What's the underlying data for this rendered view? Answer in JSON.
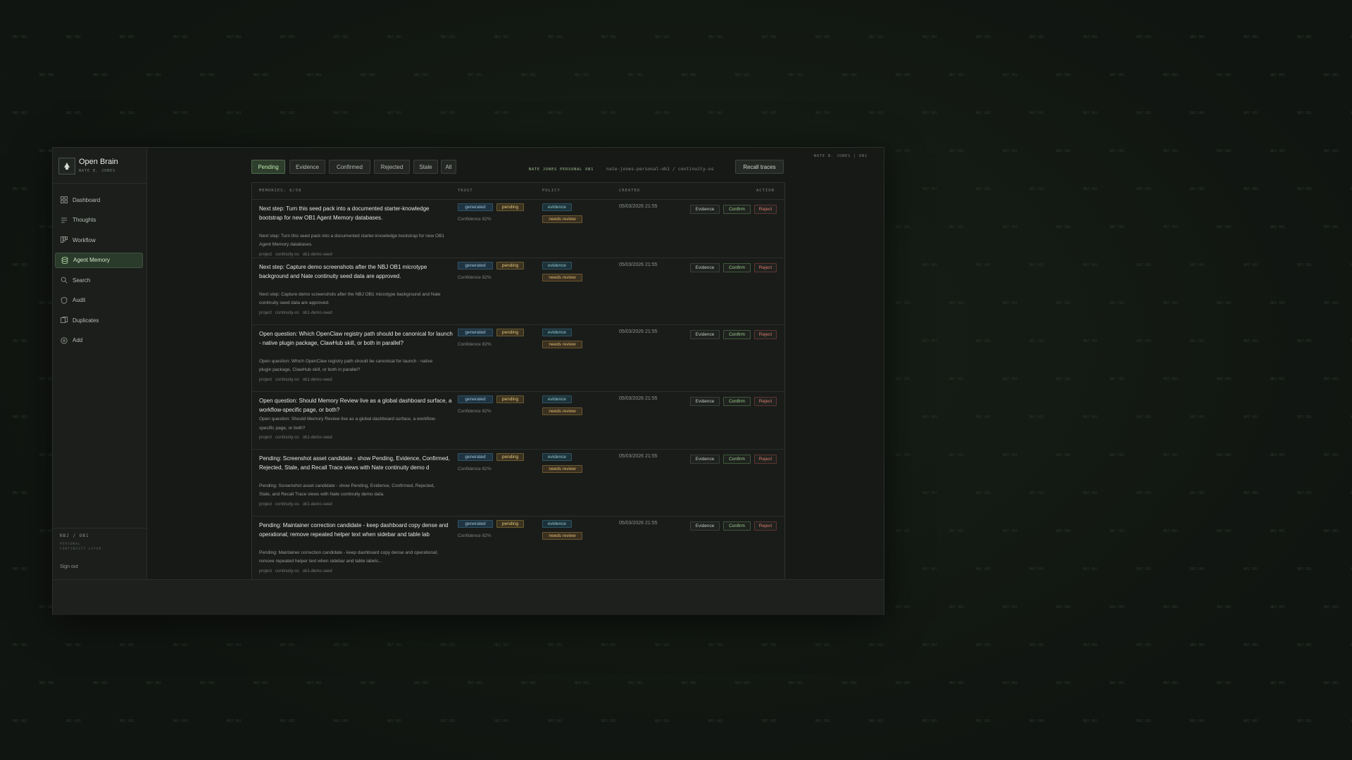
{
  "app": {
    "title": "Open Brain",
    "subtitle": "NATE B. JONES"
  },
  "sidebar": {
    "items": [
      {
        "label": "Dashboard",
        "icon": "dashboard-icon"
      },
      {
        "label": "Thoughts",
        "icon": "thoughts-icon"
      },
      {
        "label": "Workflow",
        "icon": "workflow-icon"
      },
      {
        "label": "Agent Memory",
        "icon": "database-icon",
        "active": true
      },
      {
        "label": "Search",
        "icon": "search-icon"
      },
      {
        "label": "Audit",
        "icon": "shield-icon"
      },
      {
        "label": "Duplicates",
        "icon": "duplicates-icon"
      },
      {
        "label": "Add",
        "icon": "plus-circle-icon"
      }
    ],
    "footer_code": "NBJ / OB1",
    "footer_tagline": "PERSONAL CONTINUITY LAYER",
    "signout": "Sign out"
  },
  "topbar": {
    "tabs": [
      "Pending",
      "Evidence",
      "Confirmed",
      "Rejected",
      "Stale",
      "All"
    ],
    "active_tab": "Pending",
    "context_label": "NATE JONES PERSONAL OB1",
    "context_path": "nate-jones-personal-ob1 / continuity-os",
    "recall_button": "Recall traces",
    "owner": "NATE B. JONES | OB1"
  },
  "table": {
    "headers": {
      "memories": "MEMORIES: 8/58",
      "trust": "TRUST",
      "policy": "POLICY",
      "created": "CREATED",
      "action": "ACTION"
    },
    "rows": [
      {
        "title": "Next step: Turn this seed pack into a documented starter-knowledge bootstrap for new OB1 Agent Memory databases.",
        "desc": "Next step: Turn this seed pack into a documented starter-knowledge bootstrap for new OB1 Agent Memory databases.",
        "tags": [
          "project",
          "continuity-os",
          "ob1-demo-seed"
        ],
        "trust": [
          "generated",
          "pending"
        ],
        "confidence": "Confidence 82%",
        "policy": [
          "evidence",
          "needs review"
        ],
        "created": "05/03/2026 21:55",
        "actions": [
          "Evidence",
          "Confirm",
          "Reject"
        ]
      },
      {
        "title": "Next step: Capture demo screenshots after the NBJ OB1 microtype background and Nate continuity seed data are approved.",
        "desc": "Next step: Capture demo screenshots after the NBJ OB1 microtype background and Nate continuity seed data are approved.",
        "tags": [
          "project",
          "continuity-os",
          "ob1-demo-seed"
        ],
        "trust": [
          "generated",
          "pending"
        ],
        "confidence": "Confidence 82%",
        "policy": [
          "evidence",
          "needs review"
        ],
        "created": "05/03/2026 21:55",
        "actions": [
          "Evidence",
          "Confirm",
          "Reject"
        ]
      },
      {
        "title": "Open question: Which OpenClaw registry path should be canonical for launch - native plugin package, ClawHub skill, or both in parallel?",
        "desc": "Open question: Which OpenClaw registry path should be canonical for launch - native plugin package, ClawHub skill, or both in parallel?",
        "tags": [
          "project",
          "continuity-os",
          "ob1-demo-seed"
        ],
        "trust": [
          "generated",
          "pending"
        ],
        "confidence": "Confidence 82%",
        "policy": [
          "evidence",
          "needs review"
        ],
        "created": "05/03/2026 21:55",
        "actions": [
          "Evidence",
          "Confirm",
          "Reject"
        ]
      },
      {
        "title": "Open question: Should Memory Review live as a global dashboard surface, a workflow-specific page, or both?",
        "desc": "Open question: Should Memory Review live as a global dashboard surface, a workflow-specific page, or both?",
        "tags": [
          "project",
          "continuity-os",
          "ob1-demo-seed"
        ],
        "trust": [
          "generated",
          "pending"
        ],
        "confidence": "Confidence 82%",
        "policy": [
          "evidence",
          "needs review"
        ],
        "created": "05/03/2026 21:55",
        "actions": [
          "Evidence",
          "Confirm",
          "Reject"
        ]
      },
      {
        "title": "Pending: Screenshot asset candidate - show Pending, Evidence, Confirmed, Rejected, Stale, and Recall Trace views with Nate continuity demo d",
        "desc": "Pending: Screenshot asset candidate - show Pending, Evidence, Confirmed, Rejected, Stale, and Recall Trace views with Nate continuity demo data.",
        "tags": [
          "project",
          "continuity-os",
          "ob1-demo-seed"
        ],
        "trust": [
          "generated",
          "pending"
        ],
        "confidence": "Confidence 82%",
        "policy": [
          "evidence",
          "needs review"
        ],
        "created": "05/03/2026 21:55",
        "actions": [
          "Evidence",
          "Confirm",
          "Reject"
        ]
      },
      {
        "title": "Pending: Maintainer correction candidate - keep dashboard copy dense and operational; remove repeated helper text when sidebar and table lab",
        "desc": "Pending: Maintainer correction candidate - keep dashboard copy dense and operational; remove repeated helper text when sidebar and table labels...",
        "tags": [
          "project",
          "continuity-os",
          "ob1-demo-seed"
        ],
        "trust": [
          "generated",
          "pending"
        ],
        "confidence": "Confidence 82%",
        "policy": [
          "evidence",
          "needs review"
        ],
        "created": "05/03/2026 21:55",
        "actions": [
          "Evidence",
          "Confirm",
          "Reject"
        ]
      }
    ]
  },
  "background_text": "NBJ OB1",
  "colors": {
    "accent": "#bfe3ad",
    "confirm": "#9ed28c",
    "reject": "#e07a6d",
    "pending": "#e7c67a",
    "generated": "#9fc6dc"
  }
}
